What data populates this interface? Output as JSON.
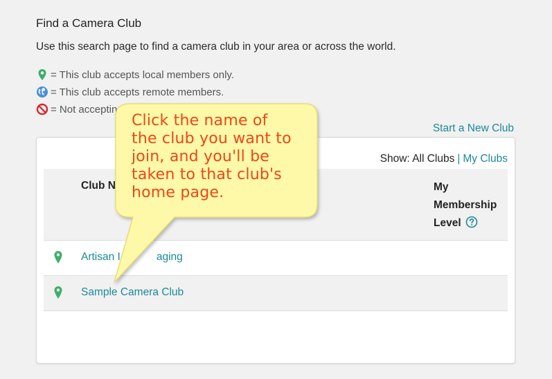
{
  "page": {
    "title": "Find a Camera Club",
    "subtitle": "Use this search page to find a camera club in your area or across the world."
  },
  "legend": [
    {
      "icon": "map-pin-icon",
      "color": "#3cb067",
      "text": "= This club accepts local members only."
    },
    {
      "icon": "globe-icon",
      "color": "#4a8fd8",
      "text": "= This club accepts remote members."
    },
    {
      "icon": "no-entry-icon",
      "color": "#d9262b",
      "text": "= Not acceptin"
    }
  ],
  "actions": {
    "start_new_club": "Start a New Club"
  },
  "filter": {
    "label": "Show:",
    "all": "All Clubs",
    "mine": "My Clubs"
  },
  "table": {
    "columns": [
      "Club N",
      "My Membership Level"
    ],
    "level_lines": [
      "My",
      "Membership",
      "Level"
    ],
    "rows": [
      {
        "icon": "map-pin-icon",
        "name": "Artisan I",
        "name_tail": "aging"
      },
      {
        "icon": "map-pin-icon",
        "name": "Sample Camera Club"
      }
    ]
  },
  "callout": {
    "lines": [
      "Click the name of",
      "the club you want to",
      "join, and you'll be",
      "taken to that club's",
      "home page."
    ],
    "fill": "#fdf9a8",
    "text_color": "#f0451a"
  },
  "colors": {
    "accent": "#1a8a98",
    "pin": "#3cb067",
    "background": "#f1f1f1"
  }
}
